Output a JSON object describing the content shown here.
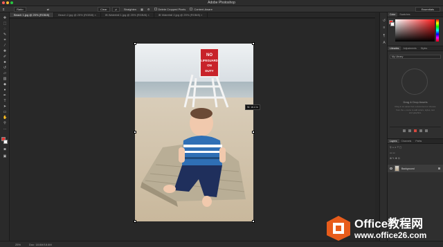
{
  "window": {
    "title": "Adobe Photoshop"
  },
  "options_bar": {
    "preset": "Ratio",
    "clear_label": "Clear",
    "straighten_label": "Straighten",
    "delete_cropped_label": "Delete Cropped Pixels",
    "content_aware_label": "Content-Aware",
    "workspace": "Essentials"
  },
  "doc_tabs": [
    {
      "label": "Beach 1.jpg @ 25% (RGB/8)",
      "active": true
    },
    {
      "label": "Beach 2.jpg @ 25% (RGB/8) ×",
      "active": false
    },
    {
      "label": "IB Waterfall 1.jpg @ 25% (RGB/8) ×",
      "active": false
    },
    {
      "label": "IB Waterfall 2.jpg @ 25% (RGB/8) ×",
      "active": false
    }
  ],
  "canvas": {
    "sign_lines": [
      "NO",
      "LIFEGUARD",
      "ON",
      "DUTY"
    ],
    "crop_tooltip": "W: 16.4 in"
  },
  "panels": {
    "color_tabs": [
      "Color",
      "Swatches"
    ],
    "library_tabs": [
      "Libraries",
      "Adjustments",
      "Styles"
    ],
    "library_select": "My Library",
    "library_heading": "Drag & Drop Assets",
    "library_body": "Drag in an asset from a document or choose from the + menu to add colors, styles, text and graphics.",
    "layers_tabs": [
      "Layers",
      "Channels",
      "Paths"
    ],
    "layer_name": "Background"
  },
  "status_bar": {
    "zoom": "25%",
    "doc_info": "Doc: 18.6M/18.6M"
  },
  "watermark": {
    "title": "Office教程网",
    "url": "www.office26.com"
  }
}
